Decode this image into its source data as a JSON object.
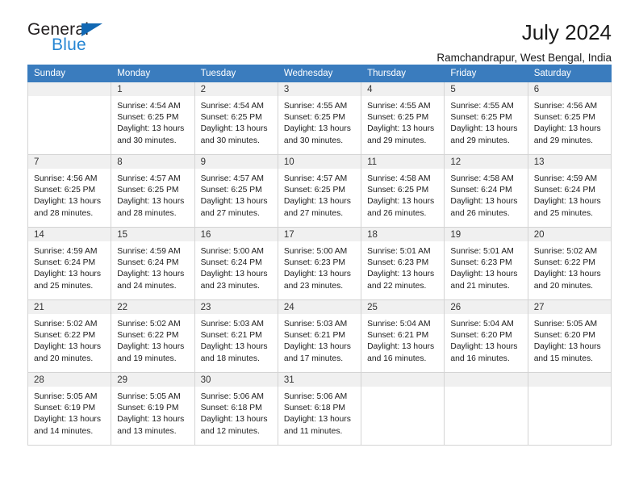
{
  "brand": {
    "name_top": "General",
    "name_bottom": "Blue",
    "accent": "#2585d3",
    "triangle_color": "#1268b3"
  },
  "header": {
    "title": "July 2024",
    "location": "Ramchandrapur, West Bengal, India"
  },
  "theme": {
    "header_row_bg": "#3a7cbe",
    "daynum_bg": "#f0f0f0",
    "grid_border": "#d4d4d4"
  },
  "weekday_headers": [
    "Sunday",
    "Monday",
    "Tuesday",
    "Wednesday",
    "Thursday",
    "Friday",
    "Saturday"
  ],
  "labels": {
    "sunrise_prefix": "Sunrise:",
    "sunset_prefix": "Sunset:",
    "daylight_prefix": "Daylight:"
  },
  "weeks": [
    [
      {
        "day": "",
        "lines": []
      },
      {
        "day": "1",
        "lines": [
          "Sunrise: 4:54 AM",
          "Sunset: 6:25 PM",
          "Daylight: 13 hours",
          "and 30 minutes."
        ]
      },
      {
        "day": "2",
        "lines": [
          "Sunrise: 4:54 AM",
          "Sunset: 6:25 PM",
          "Daylight: 13 hours",
          "and 30 minutes."
        ]
      },
      {
        "day": "3",
        "lines": [
          "Sunrise: 4:55 AM",
          "Sunset: 6:25 PM",
          "Daylight: 13 hours",
          "and 30 minutes."
        ]
      },
      {
        "day": "4",
        "lines": [
          "Sunrise: 4:55 AM",
          "Sunset: 6:25 PM",
          "Daylight: 13 hours",
          "and 29 minutes."
        ]
      },
      {
        "day": "5",
        "lines": [
          "Sunrise: 4:55 AM",
          "Sunset: 6:25 PM",
          "Daylight: 13 hours",
          "and 29 minutes."
        ]
      },
      {
        "day": "6",
        "lines": [
          "Sunrise: 4:56 AM",
          "Sunset: 6:25 PM",
          "Daylight: 13 hours",
          "and 29 minutes."
        ]
      }
    ],
    [
      {
        "day": "7",
        "lines": [
          "Sunrise: 4:56 AM",
          "Sunset: 6:25 PM",
          "Daylight: 13 hours",
          "and 28 minutes."
        ]
      },
      {
        "day": "8",
        "lines": [
          "Sunrise: 4:57 AM",
          "Sunset: 6:25 PM",
          "Daylight: 13 hours",
          "and 28 minutes."
        ]
      },
      {
        "day": "9",
        "lines": [
          "Sunrise: 4:57 AM",
          "Sunset: 6:25 PM",
          "Daylight: 13 hours",
          "and 27 minutes."
        ]
      },
      {
        "day": "10",
        "lines": [
          "Sunrise: 4:57 AM",
          "Sunset: 6:25 PM",
          "Daylight: 13 hours",
          "and 27 minutes."
        ]
      },
      {
        "day": "11",
        "lines": [
          "Sunrise: 4:58 AM",
          "Sunset: 6:25 PM",
          "Daylight: 13 hours",
          "and 26 minutes."
        ]
      },
      {
        "day": "12",
        "lines": [
          "Sunrise: 4:58 AM",
          "Sunset: 6:24 PM",
          "Daylight: 13 hours",
          "and 26 minutes."
        ]
      },
      {
        "day": "13",
        "lines": [
          "Sunrise: 4:59 AM",
          "Sunset: 6:24 PM",
          "Daylight: 13 hours",
          "and 25 minutes."
        ]
      }
    ],
    [
      {
        "day": "14",
        "lines": [
          "Sunrise: 4:59 AM",
          "Sunset: 6:24 PM",
          "Daylight: 13 hours",
          "and 25 minutes."
        ]
      },
      {
        "day": "15",
        "lines": [
          "Sunrise: 4:59 AM",
          "Sunset: 6:24 PM",
          "Daylight: 13 hours",
          "and 24 minutes."
        ]
      },
      {
        "day": "16",
        "lines": [
          "Sunrise: 5:00 AM",
          "Sunset: 6:24 PM",
          "Daylight: 13 hours",
          "and 23 minutes."
        ]
      },
      {
        "day": "17",
        "lines": [
          "Sunrise: 5:00 AM",
          "Sunset: 6:23 PM",
          "Daylight: 13 hours",
          "and 23 minutes."
        ]
      },
      {
        "day": "18",
        "lines": [
          "Sunrise: 5:01 AM",
          "Sunset: 6:23 PM",
          "Daylight: 13 hours",
          "and 22 minutes."
        ]
      },
      {
        "day": "19",
        "lines": [
          "Sunrise: 5:01 AM",
          "Sunset: 6:23 PM",
          "Daylight: 13 hours",
          "and 21 minutes."
        ]
      },
      {
        "day": "20",
        "lines": [
          "Sunrise: 5:02 AM",
          "Sunset: 6:22 PM",
          "Daylight: 13 hours",
          "and 20 minutes."
        ]
      }
    ],
    [
      {
        "day": "21",
        "lines": [
          "Sunrise: 5:02 AM",
          "Sunset: 6:22 PM",
          "Daylight: 13 hours",
          "and 20 minutes."
        ]
      },
      {
        "day": "22",
        "lines": [
          "Sunrise: 5:02 AM",
          "Sunset: 6:22 PM",
          "Daylight: 13 hours",
          "and 19 minutes."
        ]
      },
      {
        "day": "23",
        "lines": [
          "Sunrise: 5:03 AM",
          "Sunset: 6:21 PM",
          "Daylight: 13 hours",
          "and 18 minutes."
        ]
      },
      {
        "day": "24",
        "lines": [
          "Sunrise: 5:03 AM",
          "Sunset: 6:21 PM",
          "Daylight: 13 hours",
          "and 17 minutes."
        ]
      },
      {
        "day": "25",
        "lines": [
          "Sunrise: 5:04 AM",
          "Sunset: 6:21 PM",
          "Daylight: 13 hours",
          "and 16 minutes."
        ]
      },
      {
        "day": "26",
        "lines": [
          "Sunrise: 5:04 AM",
          "Sunset: 6:20 PM",
          "Daylight: 13 hours",
          "and 16 minutes."
        ]
      },
      {
        "day": "27",
        "lines": [
          "Sunrise: 5:05 AM",
          "Sunset: 6:20 PM",
          "Daylight: 13 hours",
          "and 15 minutes."
        ]
      }
    ],
    [
      {
        "day": "28",
        "lines": [
          "Sunrise: 5:05 AM",
          "Sunset: 6:19 PM",
          "Daylight: 13 hours",
          "and 14 minutes."
        ]
      },
      {
        "day": "29",
        "lines": [
          "Sunrise: 5:05 AM",
          "Sunset: 6:19 PM",
          "Daylight: 13 hours",
          "and 13 minutes."
        ]
      },
      {
        "day": "30",
        "lines": [
          "Sunrise: 5:06 AM",
          "Sunset: 6:18 PM",
          "Daylight: 13 hours",
          "and 12 minutes."
        ]
      },
      {
        "day": "31",
        "lines": [
          "Sunrise: 5:06 AM",
          "Sunset: 6:18 PM",
          "Daylight: 13 hours",
          "and 11 minutes."
        ]
      },
      {
        "day": "",
        "lines": []
      },
      {
        "day": "",
        "lines": []
      },
      {
        "day": "",
        "lines": []
      }
    ]
  ]
}
